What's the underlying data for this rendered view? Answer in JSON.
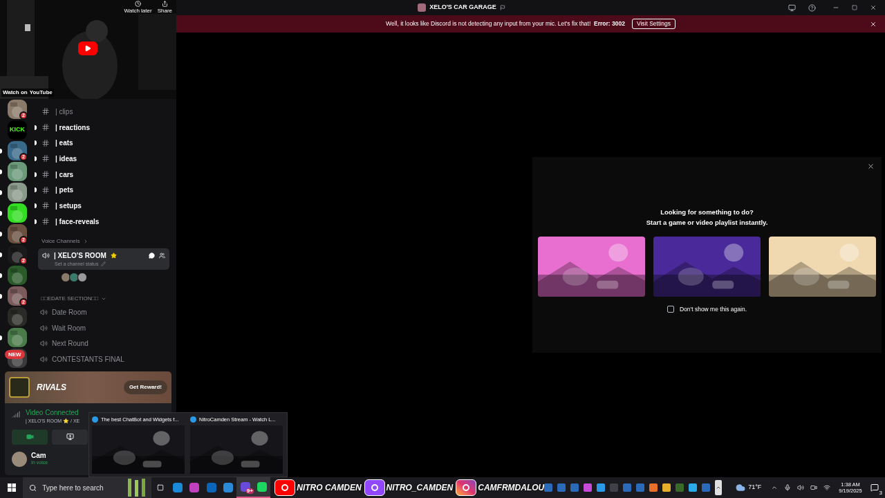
{
  "video": {
    "watch_later": "Watch later",
    "share": "Share",
    "watch_on": "Watch on",
    "brand": "YouTube"
  },
  "servers": [
    {
      "color": "#8a7a6a",
      "badge": "2",
      "unread": false
    },
    {
      "color": "#000000",
      "label": "KICK",
      "unread": false
    },
    {
      "color": "#3a6a8a",
      "badge": "2",
      "unread": true
    },
    {
      "color": "#6a9a7a",
      "unread": true
    },
    {
      "color": "#8a9a8a",
      "unread": true
    },
    {
      "color": "#33dd22",
      "unread": true
    },
    {
      "color": "#6a5040",
      "badge": "2",
      "unread": true
    },
    {
      "color": "#1a1a1a",
      "badge": "2",
      "unread": true
    },
    {
      "color": "#2a5a2a",
      "unread": true
    },
    {
      "color": "#7a5a5a",
      "badge": "2",
      "unread": true
    },
    {
      "color": "#2a2a26",
      "unread": false
    },
    {
      "color": "#4a7a4a",
      "unread": true
    },
    {
      "color": "#3a3a3a",
      "pill": "NEW",
      "unread": false
    }
  ],
  "text_channels": [
    {
      "name": "| clips",
      "unread": false
    },
    {
      "name": "| reactions",
      "unread": true
    },
    {
      "name": "| eats",
      "unread": true
    },
    {
      "name": "| ideas",
      "unread": true
    },
    {
      "name": "| cars",
      "unread": true
    },
    {
      "name": "| pets",
      "unread": true
    },
    {
      "name": "| setups",
      "unread": true
    },
    {
      "name": "| face-reveals",
      "unread": true
    }
  ],
  "voice_category": "Voice Channels",
  "active_room": {
    "name": "| XELO'S ROOM",
    "status": "Set a channel status",
    "selected": true
  },
  "date_category": "□□EDATE SECTION□□",
  "date_channels": [
    "Date Room",
    "Wait Room",
    "Next Round",
    "CONTESTANTS FINAL"
  ],
  "promo": {
    "logo": "RIVALS",
    "button": "Get Reward!"
  },
  "voice_panel": {
    "status": "Video Connected",
    "location": "| XELO'S ROOM ⭐ / XE",
    "camera_on": true
  },
  "user": {
    "name": "Cam",
    "activity": "In voice"
  },
  "thumbnails": [
    {
      "title": "The best ChatBot and Widgets f..."
    },
    {
      "title": "NitroCamden Stream - Watch L..."
    }
  ],
  "window": {
    "title": "XELO'S CAR GARAGE"
  },
  "notice": {
    "text": "Well, it looks like Discord is not detecting any input from your mic. Let's fix that!  **Error: 3002**",
    "button": "Visit Settings"
  },
  "activity_popup": {
    "heading": "Looking for something to do?",
    "subheading": "Start a game or video playlist instantly.",
    "dont_show": "Don't show me this again.",
    "checked": false
  },
  "taskbar": {
    "search_placeholder": "Type here to search",
    "apps": [
      {
        "color": "#1a8ad8",
        "running": false
      },
      {
        "color": "#c040c0",
        "running": false
      },
      {
        "color": "#0a64b8",
        "running": false
      },
      {
        "color": "#2a8ad8",
        "running": false
      },
      {
        "color": "#6a4ad8",
        "running": true,
        "badge": "9+"
      },
      {
        "color": "#1ed760",
        "running": true
      }
    ],
    "stickers": [
      {
        "kind": "youtube",
        "text": "NITRO CAMDEN"
      },
      {
        "kind": "twitch",
        "text": "NITRO_CAMDEN"
      },
      {
        "kind": "instagram",
        "text": "CAMFRMDALOU"
      }
    ],
    "tray_apps": [
      {
        "color": "#2a6ab8"
      },
      {
        "color": "#2a6ab8"
      },
      {
        "color": "#2a6ab8"
      },
      {
        "color": "#c84ad8"
      },
      {
        "color": "#2a9ae8"
      },
      {
        "color": "#404048"
      },
      {
        "color": "#2a6ab8"
      },
      {
        "color": "#2a6ab8"
      },
      {
        "color": "#e8702a"
      },
      {
        "color": "#e8b02a"
      },
      {
        "color": "#3a6a2a"
      },
      {
        "color": "#2aa8e8"
      },
      {
        "color": "#2a6ab8"
      }
    ],
    "weather": "71°F",
    "time": "1:38 AM",
    "date": "9/19/2025",
    "notifications": "3"
  }
}
